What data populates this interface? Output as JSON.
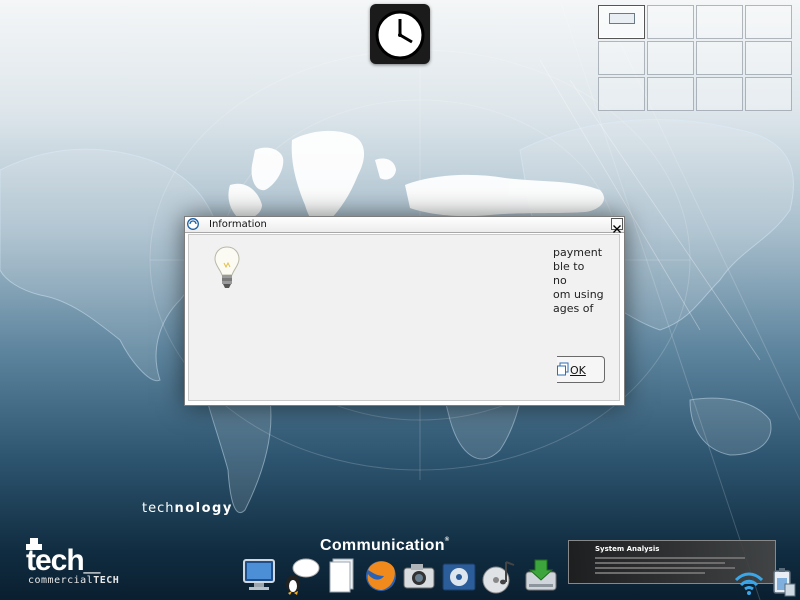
{
  "dialog": {
    "title": "Information",
    "message_lines": [
      "payment",
      "ble to",
      "no",
      "om using",
      "ages of"
    ],
    "ok_label": "OK"
  },
  "icons": {
    "clock": "clock-icon",
    "title": "info-app-icon",
    "close": "close-icon",
    "bulb": "lightbulb-icon",
    "ok": "ok-icon"
  },
  "pager": {
    "workspaces": 12,
    "active": 1
  },
  "branding": {
    "technology_light": "tech",
    "technology_bold": "nology",
    "logo_main": "tech_",
    "logo_sub_light": "commercial",
    "logo_sub_bold": "TECH"
  },
  "dock": {
    "title": "Communication",
    "items": [
      {
        "name": "monitor-icon"
      },
      {
        "name": "chat-penguin-icon"
      },
      {
        "name": "document-icon"
      },
      {
        "name": "firefox-icon"
      },
      {
        "name": "camera-icon"
      },
      {
        "name": "film-icon"
      },
      {
        "name": "music-icon"
      },
      {
        "name": "drive-download-icon"
      }
    ]
  },
  "system_panel": {
    "title": "System Analysis"
  },
  "tray": {
    "wifi": "wifi-icon",
    "battery": "battery-icon"
  },
  "colors": {
    "bg_top": "#f4f6f7",
    "bg_bottom": "#0a1f30",
    "dialog_bg": "#f1f1f1",
    "map": "#ffffff"
  }
}
